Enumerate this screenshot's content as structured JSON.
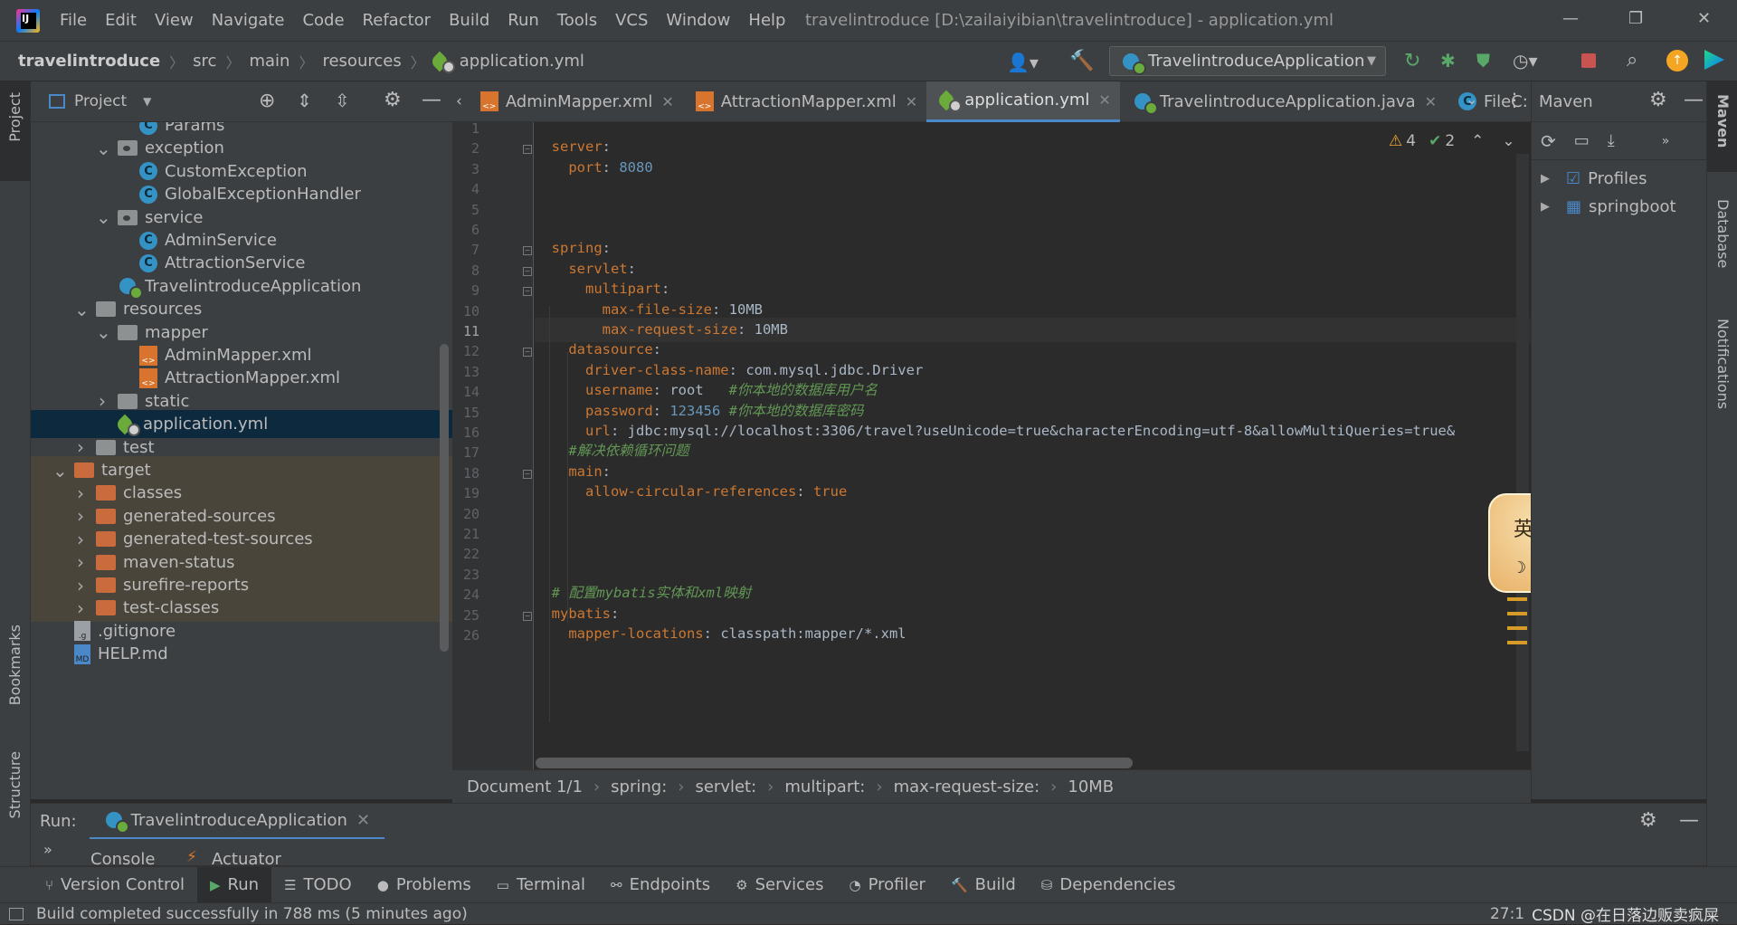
{
  "menubar": {
    "items": [
      "File",
      "Edit",
      "View",
      "Navigate",
      "Code",
      "Refactor",
      "Build",
      "Run",
      "Tools",
      "VCS",
      "Window",
      "Help"
    ],
    "window_title": "travelintroduce [D:\\zailaiyibian\\travelintroduce] - application.yml"
  },
  "breadcrumb": {
    "items": [
      "travelintroduce",
      "src",
      "main",
      "resources",
      "application.yml"
    ]
  },
  "run_config": {
    "label": "TravelintroduceApplication"
  },
  "project_panel": {
    "title": "Project"
  },
  "tree": [
    {
      "label": "Params",
      "icon": "class-icon",
      "indent": 3,
      "arrow": ""
    },
    {
      "label": "exception",
      "icon": "package-folder-icon",
      "indent": 2,
      "arrow": "open"
    },
    {
      "label": "CustomException",
      "icon": "class-icon",
      "indent": 3,
      "arrow": ""
    },
    {
      "label": "GlobalExceptionHandler",
      "icon": "class-icon",
      "indent": 3,
      "arrow": ""
    },
    {
      "label": "service",
      "icon": "package-folder-icon",
      "indent": 2,
      "arrow": "open"
    },
    {
      "label": "AdminService",
      "icon": "class-icon",
      "indent": 3,
      "arrow": ""
    },
    {
      "label": "AttractionService",
      "icon": "class-icon",
      "indent": 3,
      "arrow": ""
    },
    {
      "label": "TravelintroduceApplication",
      "icon": "spring-class-icon",
      "indent": 2,
      "arrow": ""
    },
    {
      "label": "resources",
      "icon": "resources-folder-icon",
      "indent": 1,
      "arrow": "open"
    },
    {
      "label": "mapper",
      "icon": "folder-icon",
      "indent": 2,
      "arrow": "open"
    },
    {
      "label": "AdminMapper.xml",
      "icon": "xml-icon",
      "indent": 3,
      "arrow": ""
    },
    {
      "label": "AttractionMapper.xml",
      "icon": "xml-icon",
      "indent": 3,
      "arrow": ""
    },
    {
      "label": "static",
      "icon": "folder-icon",
      "indent": 2,
      "arrow": "closed"
    },
    {
      "label": "application.yml",
      "icon": "yml-icon",
      "indent": 2,
      "arrow": "",
      "selected": true
    },
    {
      "label": "test",
      "icon": "folder-icon",
      "indent": 1,
      "arrow": "closed"
    },
    {
      "label": "target",
      "icon": "excluded-folder-icon",
      "indent": 0,
      "arrow": "open",
      "excluded": true
    },
    {
      "label": "classes",
      "icon": "excluded-folder-icon",
      "indent": 1,
      "arrow": "closed",
      "excluded": true
    },
    {
      "label": "generated-sources",
      "icon": "excluded-folder-icon",
      "indent": 1,
      "arrow": "closed",
      "excluded": true
    },
    {
      "label": "generated-test-sources",
      "icon": "excluded-folder-icon",
      "indent": 1,
      "arrow": "closed",
      "excluded": true
    },
    {
      "label": "maven-status",
      "icon": "excluded-folder-icon",
      "indent": 1,
      "arrow": "closed",
      "excluded": true
    },
    {
      "label": "surefire-reports",
      "icon": "excluded-folder-icon",
      "indent": 1,
      "arrow": "closed",
      "excluded": true
    },
    {
      "label": "test-classes",
      "icon": "excluded-folder-icon",
      "indent": 1,
      "arrow": "closed",
      "excluded": true
    },
    {
      "label": ".gitignore",
      "icon": "gitignore-icon",
      "indent": 0,
      "arrow": ""
    },
    {
      "label": "HELP.md",
      "icon": "markdown-icon",
      "indent": 0,
      "arrow": ""
    }
  ],
  "tabs": [
    {
      "label": "AdminMapper.xml",
      "icon": "xml-icon"
    },
    {
      "label": "AttractionMapper.xml",
      "icon": "xml-icon"
    },
    {
      "label": "application.yml",
      "icon": "yml-icon",
      "active": true
    },
    {
      "label": "TravelintroduceApplication.java",
      "icon": "spring-class-icon"
    },
    {
      "label": "FileC:",
      "icon": "class-icon"
    }
  ],
  "inspections": {
    "warnings": "4",
    "ok": "2"
  },
  "code": [
    {
      "n": "1",
      "t": ""
    },
    {
      "n": "2",
      "t": "server:"
    },
    {
      "n": "3",
      "t": "  port: 8080"
    },
    {
      "n": "4",
      "t": ""
    },
    {
      "n": "5",
      "t": ""
    },
    {
      "n": "6",
      "t": ""
    },
    {
      "n": "7",
      "t": "spring:"
    },
    {
      "n": "8",
      "t": "  servlet:"
    },
    {
      "n": "9",
      "t": "    multipart:"
    },
    {
      "n": "10",
      "t": "      max-file-size: 10MB"
    },
    {
      "n": "11",
      "t": "      max-request-size: 10MB",
      "current": true
    },
    {
      "n": "12",
      "t": "  datasource:"
    },
    {
      "n": "13",
      "t": "    driver-class-name: com.mysql.jdbc.Driver"
    },
    {
      "n": "14",
      "t": "    username: root   #你本地的数据库用户名"
    },
    {
      "n": "15",
      "t": "    password: 123456 #你本地的数据库密码"
    },
    {
      "n": "16",
      "t": "    url: jdbc:mysql://localhost:3306/travel?useUnicode=true&characterEncoding=utf-8&allowMultiQueries=true&"
    },
    {
      "n": "17",
      "t": "  #解决依赖循环问题"
    },
    {
      "n": "18",
      "t": "  main:"
    },
    {
      "n": "19",
      "t": "    allow-circular-references: true"
    },
    {
      "n": "20",
      "t": ""
    },
    {
      "n": "21",
      "t": ""
    },
    {
      "n": "22",
      "t": ""
    },
    {
      "n": "23",
      "t": ""
    },
    {
      "n": "24",
      "t": "# 配置mybatis实体和xml映射"
    },
    {
      "n": "25",
      "t": "mybatis:"
    },
    {
      "n": "26",
      "t": "  mapper-locations: classpath:mapper/*.xml"
    }
  ],
  "editor_breadcrumb": [
    "Document 1/1",
    "spring:",
    "servlet:",
    "multipart:",
    "max-request-size:",
    "10MB"
  ],
  "maven": {
    "title": "Maven",
    "items": [
      "Profiles",
      "springboot"
    ]
  },
  "right_strip": [
    "Maven",
    "Database",
    "Notifications"
  ],
  "left_strip": [
    "Project",
    "Bookmarks",
    "Structure"
  ],
  "run": {
    "label": "Run:",
    "config": "TravelintroduceApplication",
    "subtabs": [
      "Console",
      "Actuator"
    ]
  },
  "toolwindows": [
    "Version Control",
    "Run",
    "TODO",
    "Problems",
    "Terminal",
    "Endpoints",
    "Services",
    "Profiler",
    "Build",
    "Dependencies"
  ],
  "status": {
    "message": "Build completed successfully in 788 ms (5 minutes ago)",
    "position": "27:1",
    "watermark": "CSDN @在日落边贩卖疯屎"
  },
  "sticker_text": "英"
}
